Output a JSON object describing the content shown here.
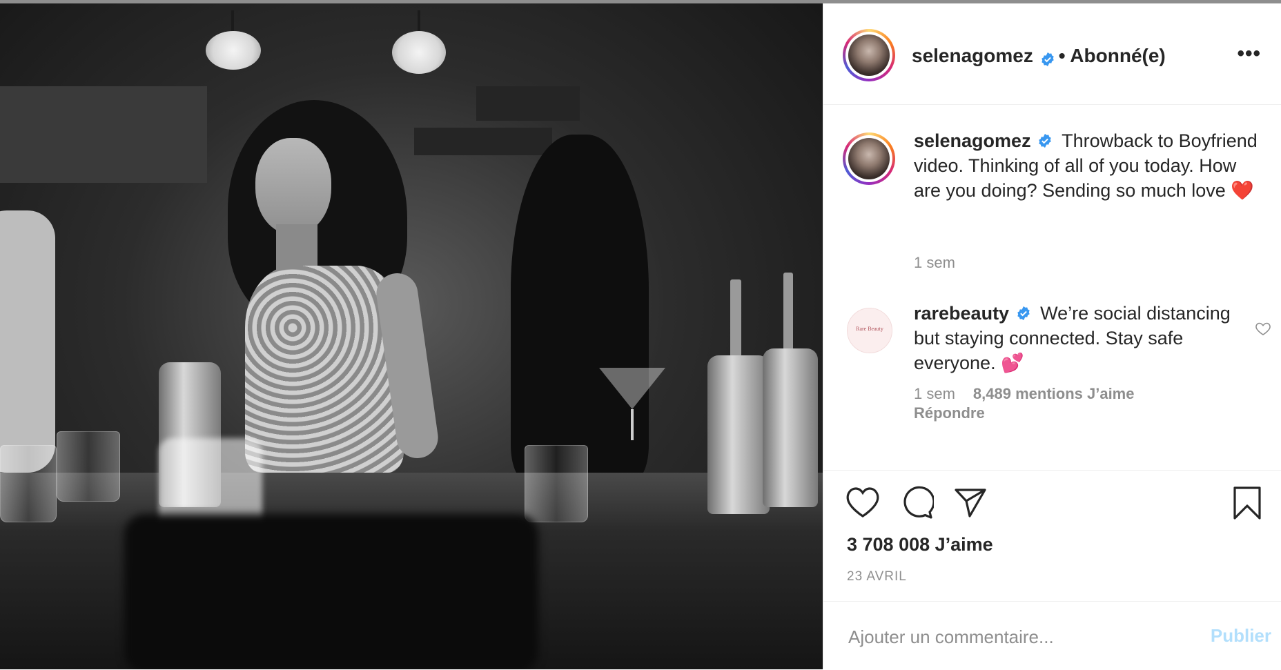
{
  "post": {
    "author": "selenagomez",
    "follow_status": "• Abonné(e)",
    "more_label": "•••"
  },
  "caption": {
    "username": "selenagomez",
    "text": "Throwback to Boyfriend video. Thinking of all of you today. How are you doing? Sending so much love ❤️",
    "time": "1 sem"
  },
  "comments": [
    {
      "username": "rarebeauty",
      "avatar_text": "Rare Beauty",
      "text": "We’re social distancing but staying connected. Stay safe everyone. 💕",
      "time": "1 sem",
      "likes": "8,489 mentions J’aime",
      "reply_label": "Répondre"
    }
  ],
  "stats": {
    "likes": "3 708 008 J’aime",
    "date": "23 AVRIL"
  },
  "add_comment": {
    "placeholder": "Ajouter un commentaire...",
    "publish_label": "Publier"
  },
  "colors": {
    "verified": "#3897f0",
    "publish_disabled": "#b2dffc",
    "secondary_text": "#8e8e8e",
    "primary_text": "#262626"
  },
  "icons": [
    "verified-badge-icon",
    "more-icon",
    "heart-icon",
    "comment-icon",
    "share-icon",
    "bookmark-icon"
  ]
}
